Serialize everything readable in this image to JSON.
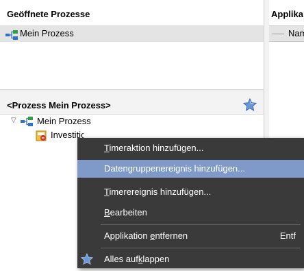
{
  "open_processes": {
    "header": "Geöffnete Prozesse",
    "items": [
      {
        "label": "Mein Prozess"
      }
    ]
  },
  "application_panel": {
    "title": "Applika",
    "column_name": "Nam"
  },
  "process_tree": {
    "header": "<Prozess Mein Prozess>",
    "root": "Mein Prozess",
    "child": "Investitionsantrag"
  },
  "context_menu": {
    "items": [
      {
        "pre": "",
        "u": "T",
        "post": "imeraktion hinzufügen..."
      },
      {
        "pre": "Daten",
        "u": "g",
        "post": "ruppenereignis hinzufügen..."
      },
      {
        "pre": "",
        "u": "T",
        "post": "imerereignis hinzufügen..."
      },
      {
        "pre": "",
        "u": "B",
        "post": "earbeiten"
      },
      {
        "pre": "Applikation ",
        "u": "e",
        "post": "ntfernen",
        "shortcut": "Entf"
      },
      {
        "pre": "Alles auf",
        "u": "k",
        "post": "lappen"
      }
    ]
  },
  "colors": {
    "menu_bg": "#3a3a3a",
    "menu_selected": "#7f9ac9",
    "row_selected": "#e4e4e4"
  }
}
